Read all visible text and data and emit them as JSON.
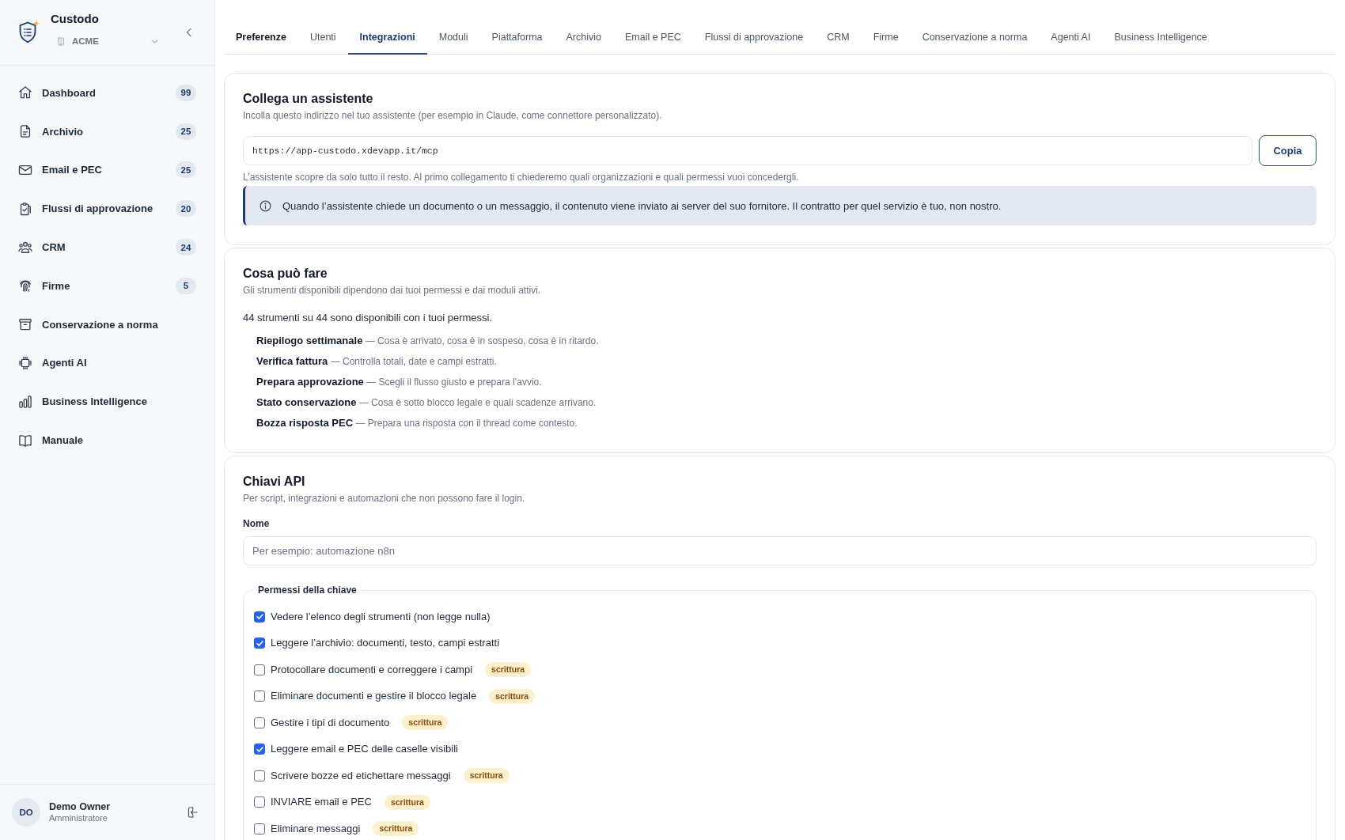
{
  "sidebar": {
    "brand": {
      "name": "Custodo",
      "organization": "ACME"
    },
    "items": [
      {
        "label": "Dashboard",
        "count": "99"
      },
      {
        "label": "Archivio",
        "count": "25"
      },
      {
        "label": "Email e PEC",
        "count": "25"
      },
      {
        "label": "Flussi di approvazione",
        "count": "20"
      },
      {
        "label": "CRM",
        "count": "24"
      },
      {
        "label": "Firme",
        "count": "5"
      },
      {
        "label": "Conservazione a norma"
      },
      {
        "label": "Agenti AI"
      },
      {
        "label": "Business Intelligence"
      },
      {
        "label": "Manuale"
      }
    ],
    "user": {
      "initials": "DO",
      "name": "Demo Owner",
      "role": "Amministratore"
    }
  },
  "tabs": [
    {
      "label": "Preferenze",
      "selected": false,
      "hovered": true
    },
    {
      "label": "Utenti",
      "selected": false,
      "hovered": false
    },
    {
      "label": "Integrazioni",
      "selected": true,
      "hovered": false
    },
    {
      "label": "Moduli",
      "selected": false,
      "hovered": false
    },
    {
      "label": "Piattaforma",
      "selected": false,
      "hovered": false
    },
    {
      "label": "Archivio",
      "selected": false,
      "hovered": false
    },
    {
      "label": "Email e PEC",
      "selected": false,
      "hovered": false
    },
    {
      "label": "Flussi di approvazione",
      "selected": false,
      "hovered": false
    },
    {
      "label": "CRM",
      "selected": false,
      "hovered": false
    },
    {
      "label": "Firme",
      "selected": false,
      "hovered": false
    },
    {
      "label": "Conservazione a norma",
      "selected": false,
      "hovered": false
    },
    {
      "label": "Agenti AI",
      "selected": false,
      "hovered": false
    },
    {
      "label": "Business Intelligence",
      "selected": false,
      "hovered": false
    }
  ],
  "assistant_card": {
    "title": "Collega un assistente",
    "subtitle": "Incolla questo indirizzo nel tuo assistente (per esempio in Claude, come connettore personalizzato).",
    "url_field": {
      "value": "https://app-custodo.xdevapp.it/mcp"
    },
    "copy_button": "Copia",
    "note": "L’assistente scopre da solo tutto il resto. Al primo collegamento ti chiederemo quali organizzazioni e quali permessi vuoi concedergli.",
    "info": "Quando l’assistente chiede un documento o un messaggio, il contenuto viene inviato ai server del suo fornitore. Il contratto per quel servizio è tuo, non nostro."
  },
  "capabilities_card": {
    "title": "Cosa può fare",
    "subtitle": "Gli strumenti disponibili dipendono dai tuoi permessi e dai moduli attivi.",
    "summary": "44 strumenti su 44 sono disponibili con i tuoi permessi.",
    "tools": [
      "**Riepilogo settimanale** — Cosa è arrivato, cosa è in sospeso, cosa è in ritardo.",
      "**Verifica fattura** — Controlla totali, date e campi estratti.",
      "**Prepara approvazione** — Scegli il flusso giusto e prepara l’avvio.",
      "**Stato conservazione** — Cosa è sotto blocco legale e quali scadenze arrivano.",
      "**Bozza risposta PEC** — Prepara una risposta con il thread come contesto."
    ]
  },
  "api_keys_card": {
    "title": "Chiavi API",
    "subtitle": "Per script, integrazioni e automazioni che non possono fare il login.",
    "name_field": {
      "label": "Nome",
      "placeholder": "Per esempio: automazione n8n"
    },
    "permissions": {
      "legend": "Permessi della chiave",
      "items": [
        {
          "label": "Vedere l’elenco degli strumenti (non legge nulla)",
          "checked": true
        },
        {
          "label": "Leggere l’archivio: documenti, testo, campi estratti",
          "checked": true
        },
        {
          "label": "Protocollare documenti e correggere i campi",
          "checked": false,
          "tag": "scrittura"
        },
        {
          "label": "Eliminare documenti e gestire il blocco legale",
          "checked": false,
          "tag": "scrittura"
        },
        {
          "label": "Gestire i tipi di documento",
          "checked": false,
          "tag": "scrittura"
        },
        {
          "label": "Leggere email e PEC delle caselle visibili",
          "checked": true
        },
        {
          "label": "Scrivere bozze ed etichettare messaggi",
          "checked": false,
          "tag": "scrittura"
        },
        {
          "label": "INVIARE email e PEC",
          "checked": false,
          "tag": "scrittura"
        },
        {
          "label": "Eliminare messaggi",
          "checked": false,
          "tag": "scrittura"
        }
      ]
    }
  }
}
